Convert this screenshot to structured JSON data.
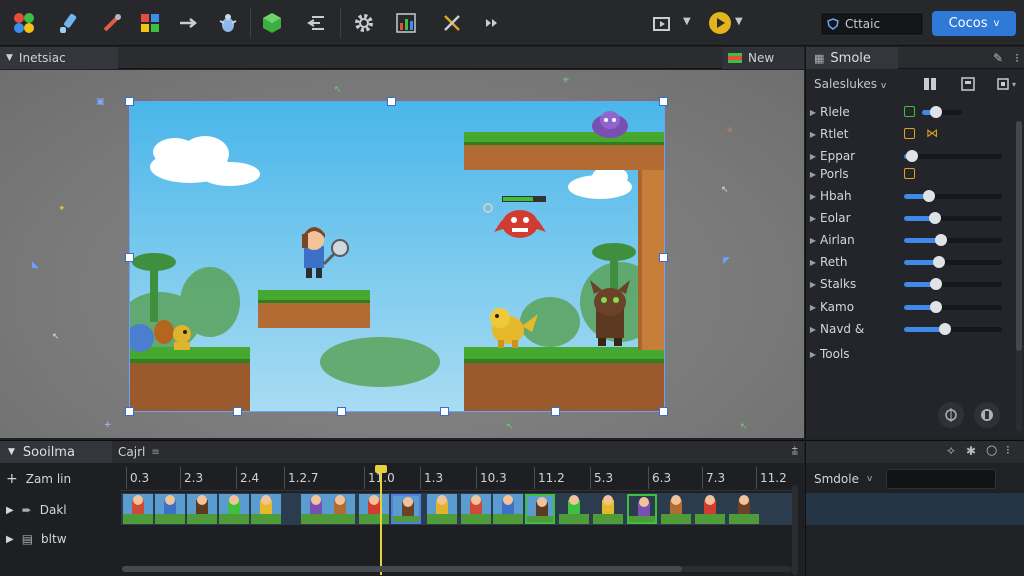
{
  "toolbar": {
    "icons": [
      "color-blocks-icon",
      "brush-icon",
      "eyedropper-icon",
      "palette-icon",
      "move-arrow-icon",
      "bug-icon",
      "cube-icon",
      "align-icon",
      "gear-icon",
      "chart-icon",
      "tools-icon",
      "fast-forward-icon",
      "export-icon",
      "play-icon"
    ],
    "search_text": "Cttaic",
    "cocos_label": "Cocos",
    "cocos_caret": "v"
  },
  "scene": {
    "tab_label": "Inetsiac",
    "new_tab_label": "New"
  },
  "inspector": {
    "tab_label": "Smole",
    "dropdown_label": "Saleslukes",
    "dropdown_caret": "v",
    "properties": [
      {
        "label": "Rlele",
        "kind": "slider",
        "level": 0.35,
        "box_color": "#3fbf3f"
      },
      {
        "label": "Rtlet",
        "kind": "box",
        "box_color": "#e0a520",
        "extra": "⋈"
      },
      {
        "label": "Eppar",
        "kind": "slider",
        "level": 0.08
      },
      {
        "label": "Porls",
        "kind": "box",
        "box_color": "#e0a520"
      },
      {
        "label": "Hbah",
        "kind": "slider",
        "level": 0.25
      },
      {
        "label": "Eolar",
        "kind": "slider",
        "level": 0.32
      },
      {
        "label": "Airlan",
        "kind": "slider",
        "level": 0.38
      },
      {
        "label": "Reth",
        "kind": "slider",
        "level": 0.36
      },
      {
        "label": "Stalks",
        "kind": "slider",
        "level": 0.33
      },
      {
        "label": "Kamo",
        "kind": "slider",
        "level": 0.33
      },
      {
        "label": "Navd &",
        "kind": "slider",
        "level": 0.42
      },
      {
        "label": "Tools",
        "kind": "none"
      }
    ]
  },
  "timeline": {
    "tab_label": "Sooilma",
    "tab2_label": "Cajrl",
    "zoom_label": "Zam lin",
    "ticks": [
      "0.3",
      "2.3",
      "2.4",
      "1.2.7",
      "11.0",
      "1.3",
      "10.3",
      "11.2",
      "5.3",
      "6.3",
      "7.3",
      "11.2"
    ],
    "tracks": [
      {
        "label": "Dakl"
      },
      {
        "label": "bltw"
      }
    ],
    "right_panel_label": "Smdole",
    "right_panel_caret": "v"
  }
}
